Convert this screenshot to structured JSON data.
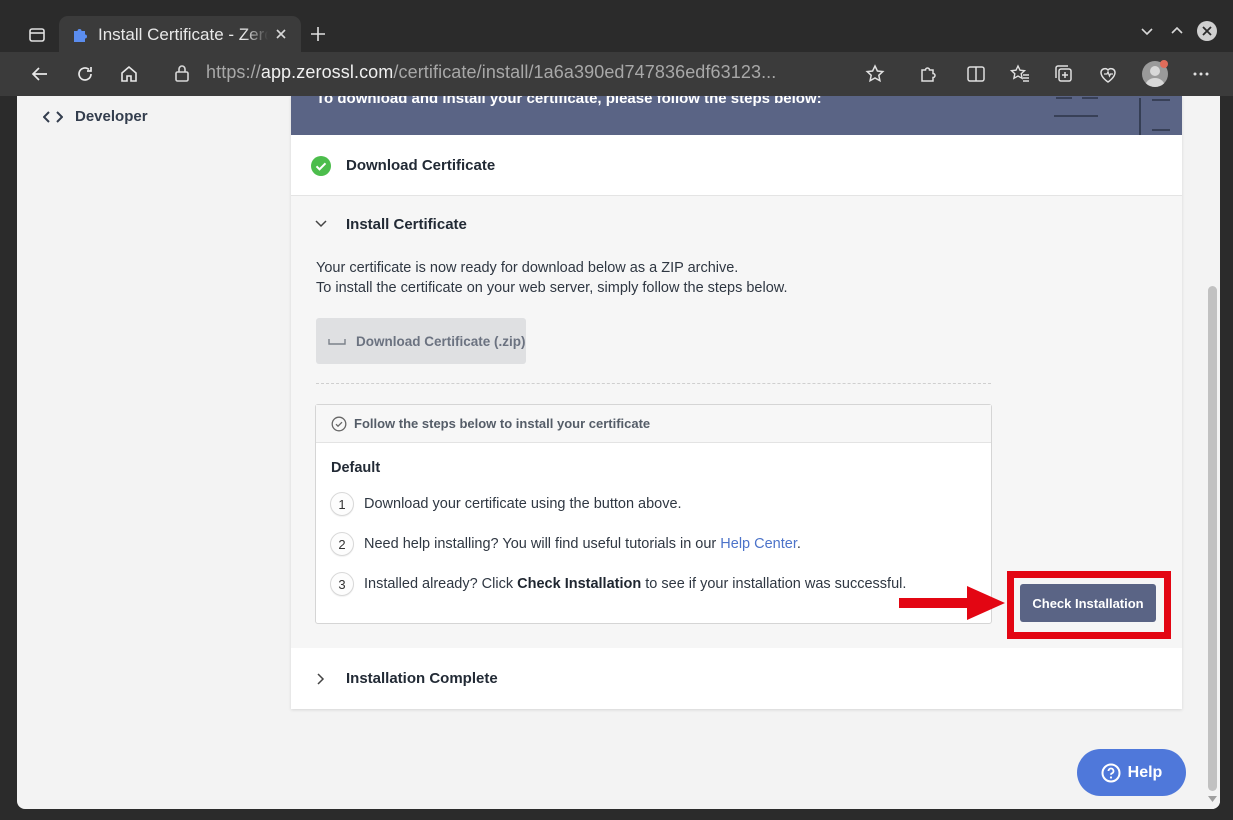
{
  "browser": {
    "tab_title": "Install Certificate - ZeroSSL",
    "url_prefix": "https://",
    "url_host": "app.zerossl.com",
    "url_path": "/certificate/install/1a6a390ed747836edf63123..."
  },
  "sidebar": {
    "developer_label": "Developer"
  },
  "hero": {
    "text": "To download and install your certificate, please follow the steps below:"
  },
  "steps": {
    "download_certificate": "Download Certificate",
    "install_certificate": "Install Certificate",
    "installation_complete": "Installation Complete"
  },
  "install": {
    "line1": "Your certificate is now ready for download below as a ZIP archive.",
    "line2": "To install the certificate on your web server, simply follow the steps below.",
    "download_button": "Download Certificate (.zip)",
    "instructions_header": "Follow the steps below to install your certificate",
    "server_label": "Default",
    "step1_num": "1",
    "step1_text": "Download your certificate using the button above.",
    "step2_num": "2",
    "step2_text": "Need help installing? You will find useful tutorials in our ",
    "step2_link": "Help Center",
    "step2_end": ".",
    "step3_num": "3",
    "step3_pre": "Installed already? Click ",
    "step3_bold": "Check Installation",
    "step3_post": " to see if your installation was successful.",
    "check_button": "Check Installation"
  },
  "help": {
    "label": "Help"
  },
  "colors": {
    "accent": "#5a6485",
    "link": "#4c73c9",
    "success": "#4cbd4c",
    "annotation_red": "#e30613",
    "help_blue": "#4f78da"
  }
}
